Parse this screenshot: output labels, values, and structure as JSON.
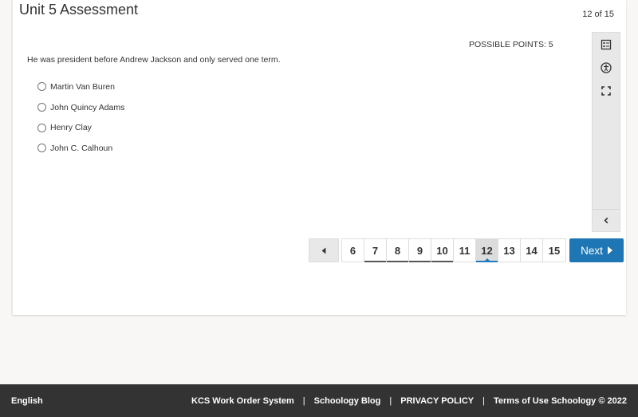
{
  "header": {
    "title": "Unit 5 Assessment",
    "counter": "12 of 15"
  },
  "question": {
    "points": "POSSIBLE POINTS: 5",
    "text": "He was president before Andrew Jackson and only served one term.",
    "choices": [
      {
        "label": "Martin Van Buren",
        "selected": false
      },
      {
        "label": "John Quincy Adams",
        "selected": false
      },
      {
        "label": "Henry Clay",
        "selected": false
      },
      {
        "label": "John C. Calhoun",
        "selected": false
      }
    ]
  },
  "sidepanel": {
    "icons": [
      "question-list-icon",
      "accessibility-icon",
      "fullscreen-icon",
      "chevron-left-icon"
    ]
  },
  "pager": {
    "pages": [
      "6",
      "7",
      "8",
      "9",
      "10",
      "11",
      "12",
      "13",
      "14",
      "15"
    ],
    "answered": [
      "7",
      "8",
      "9",
      "10"
    ],
    "current": "12",
    "next_label": "Next"
  },
  "footer": {
    "language": "English",
    "links": [
      "KCS Work Order System",
      "Schoology Blog",
      "PRIVACY POLICY",
      "Terms of Use"
    ],
    "separator": "|",
    "copyright": "Schoology © 2022"
  },
  "colors": {
    "accent": "#1f76b5",
    "footer_bg": "#333333",
    "page_bg": "#f8f7f5"
  }
}
